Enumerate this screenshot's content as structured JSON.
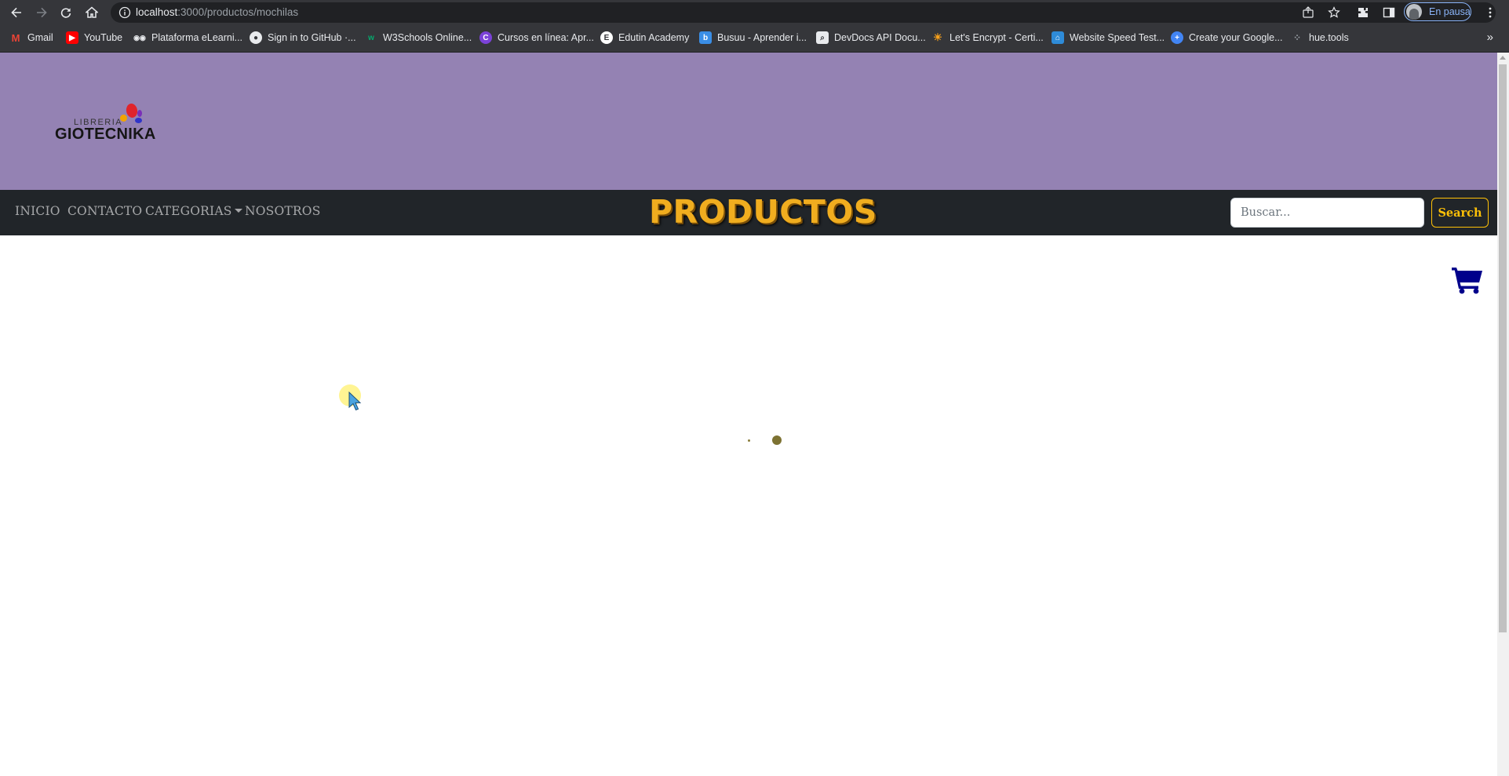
{
  "browser": {
    "url_host": "localhost",
    "url_path": ":3000/productos/mochilas",
    "profile_label": "En pausa"
  },
  "bookmarks": [
    {
      "label": "Gmail",
      "icon": "gmail-icon",
      "color": "#ea4335"
    },
    {
      "label": "YouTube",
      "icon": "youtube-icon",
      "color": "#ff0000"
    },
    {
      "label": "Plataforma eLearni...",
      "icon": "elearning-icon",
      "color": "#ffffff"
    },
    {
      "label": "Sign in to GitHub ·...",
      "icon": "github-icon",
      "color": "#ffffff"
    },
    {
      "label": "W3Schools Online...",
      "icon": "w3schools-icon",
      "color": "#04aa6d"
    },
    {
      "label": "Cursos en línea: Apr...",
      "icon": "courses-icon",
      "color": "#7b42d8"
    },
    {
      "label": "Edutin Academy",
      "icon": "edutin-icon",
      "color": "#ffffff"
    },
    {
      "label": "Busuu - Aprender i...",
      "icon": "busuu-icon",
      "color": "#3a8ee6"
    },
    {
      "label": "DevDocs API Docu...",
      "icon": "devdocs-icon",
      "color": "#ffffff"
    },
    {
      "label": "Let's Encrypt - Certi...",
      "icon": "letsencrypt-icon",
      "color": "#f9a11b"
    },
    {
      "label": "Website Speed Test...",
      "icon": "speedtest-icon",
      "color": "#2e8bd8"
    },
    {
      "label": "Create your Google...",
      "icon": "google-icon",
      "color": "#4285f4"
    },
    {
      "label": "hue.tools",
      "icon": "hue-icon",
      "color": "#9aa0a6"
    }
  ],
  "site": {
    "logo_small": "LIBRERIA",
    "logo_big": "GIOTECNIKA",
    "brand_title": "PRODUCTOS",
    "nav": {
      "inicio": "INICIO",
      "contacto": "CONTACTO",
      "categorias": "CATEGORIAS",
      "nosotros": "NOSOTROS"
    },
    "search": {
      "placeholder": "Buscar...",
      "button_label": "Search"
    }
  },
  "colors": {
    "hero_bg": "#9482b3",
    "navbar_bg": "#212529",
    "brand_color": "#f0ad1f",
    "accent": "#ffc107",
    "cart_color": "#00008b"
  }
}
